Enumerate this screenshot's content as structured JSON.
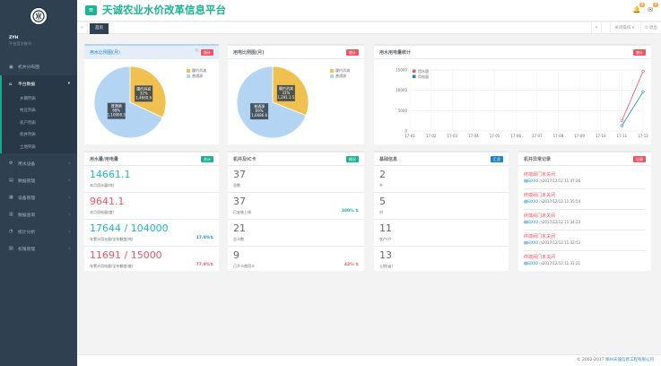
{
  "app": {
    "title": "天诚农业水价改革信息平台"
  },
  "sidebar": {
    "username": "ZYH",
    "role": "平台官方账号",
    "items": [
      {
        "icon": "▣",
        "label": "机井分布图"
      },
      {
        "icon": "⌂",
        "label": "平台数据"
      },
      {
        "icon": "⚙",
        "label": "用水设备"
      },
      {
        "icon": "▤",
        "label": "数据管理"
      },
      {
        "icon": "▦",
        "label": "设备管理"
      },
      {
        "icon": "▥",
        "label": "数据查询"
      },
      {
        "icon": "◔",
        "label": "统计分析"
      },
      {
        "icon": "▧",
        "label": "权限管理"
      }
    ],
    "sub_items": [
      "乡镇列表",
      "村庄列表",
      "农户列表",
      "机井列表",
      "土地列表"
    ]
  },
  "topbar": {
    "badge1": "8",
    "badge2": "8"
  },
  "tabs": {
    "home": "首页",
    "actions": "关闭操作",
    "exit": "退出"
  },
  "pie1": {
    "title": "用水比例图(月)",
    "label": "统计",
    "series": [
      {
        "name": "履约消减",
        "value": "1,4660.6",
        "pct": "32%",
        "color": "#f0c050"
      },
      {
        "name": "普通源",
        "value": "1,10000.5",
        "pct": "68%",
        "color": "#b3d5f3"
      }
    ]
  },
  "pie2": {
    "title": "用电比例图(月)",
    "label": "统计",
    "series": [
      {
        "name": "履约消减",
        "value": "1,291.1.5",
        "pct": "31%",
        "color": "#f0c050"
      },
      {
        "name": "普通源",
        "value": "1,6686.6",
        "pct": "69%",
        "color": "#b3d5f3"
      }
    ]
  },
  "line": {
    "title": "用水用电量统计",
    "label": "统计"
  },
  "chart_data": {
    "type": "line",
    "x": [
      "17-01",
      "17-02",
      "17-03",
      "17-04",
      "17-05",
      "17-06",
      "17-07",
      "17-08",
      "17-09",
      "17-10",
      "17-11",
      "17-12"
    ],
    "series": [
      {
        "name": "用水量",
        "color": "#ed5565",
        "values": [
          null,
          null,
          null,
          null,
          null,
          null,
          null,
          null,
          null,
          null,
          2500,
          14661
        ]
      },
      {
        "name": "用电量",
        "color": "#1c84c6",
        "values": [
          null,
          null,
          null,
          null,
          null,
          null,
          null,
          null,
          null,
          null,
          1300,
          9641
        ]
      }
    ],
    "yticks": [
      "0",
      "5000",
      "10000",
      "15000"
    ],
    "ylim": [
      0,
      15000
    ]
  },
  "usage": {
    "title": "用水量/用电量",
    "label": "合计",
    "stats": [
      {
        "value": "14661.1",
        "label": "本月用水量(吨)",
        "color": "#23b7c4",
        "pct": ""
      },
      {
        "value": "9641.1",
        "label": "本月用电量(度)",
        "color": "#ed5565",
        "pct": ""
      },
      {
        "value": "17644 / 104000",
        "label": "年累计用水量/全年额度(吨)",
        "color": "#23b7c4",
        "pct": "17.0%⇅",
        "pct_color": "#1c84c6"
      },
      {
        "value": "11691 / 15000",
        "label": "年累计用电量/全年额度(度)",
        "color": "#ed5565",
        "pct": "77.9%⇅",
        "pct_color": "#ed5565"
      }
    ]
  },
  "wells": {
    "title": "机井及IC卡",
    "label": "概况",
    "stats": [
      {
        "value": "37",
        "label": "总数",
        "pct": ""
      },
      {
        "value": "37",
        "label": "已安装上线",
        "pct": "100% ⇅",
        "pct_color": "#1ab394"
      },
      {
        "value": "21",
        "label": "总卡数",
        "pct": ""
      },
      {
        "value": "9",
        "label": "已开卡使用卡",
        "pct": "42% ⇅",
        "pct_color": "#ed5565"
      }
    ]
  },
  "basic": {
    "title": "基础信息",
    "label": "汇总",
    "stats": [
      {
        "value": "2",
        "label": "乡"
      },
      {
        "value": "5",
        "label": "村"
      },
      {
        "value": "11",
        "label": "农户/户"
      },
      {
        "value": "13",
        "label": "土地(亩)"
      }
    ]
  },
  "records": {
    "title": "机井异常记录",
    "label": "记录",
    "items": [
      {
        "title": "终端阀门未关闭",
        "dev": "编码XX0",
        "time": "◷2017/12/12 11:37:26"
      },
      {
        "title": "终端阀门未关闭",
        "dev": "编码XX0",
        "time": "◷2017/12/12 11:35:54"
      },
      {
        "title": "终端阀门未关闭",
        "dev": "编码XX0",
        "time": "◷2017/12/12 11:34:23"
      },
      {
        "title": "终端阀门未关闭",
        "dev": "编码XX0",
        "time": "◷2017/12/12 11:32:53"
      },
      {
        "title": "终端阀门未关闭",
        "dev": "编码XX0",
        "time": "◷2017/12/12 11:31:21"
      }
    ]
  },
  "footer": {
    "copyright": "© 2002-2017",
    "company": "郑州天诚信息工程有限公司"
  }
}
